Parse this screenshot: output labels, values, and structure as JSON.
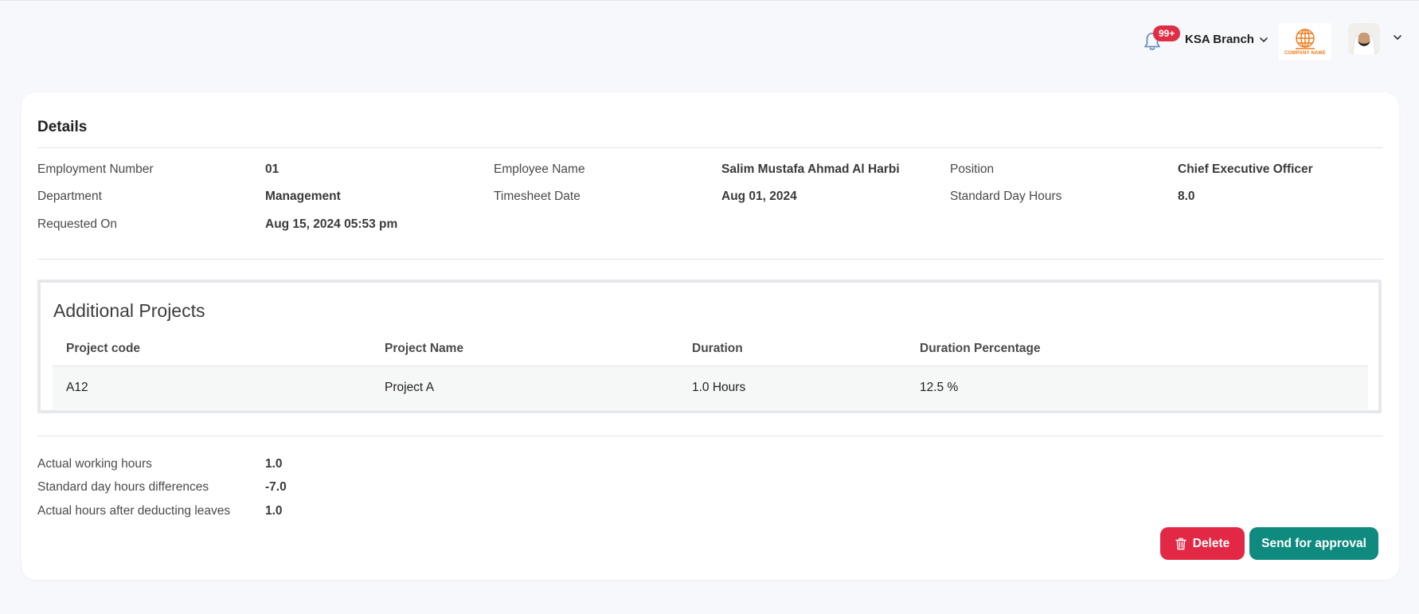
{
  "header": {
    "notification_badge": "99+",
    "branch": "KSA Branch",
    "company_logo_text": "COMPANY NAME",
    "colors": {
      "badge": "#e02e44",
      "logo": "#f07a1a"
    }
  },
  "details": {
    "title": "Details",
    "fields": {
      "employment_number": {
        "label": "Employment Number",
        "value": "01"
      },
      "employee_name": {
        "label": "Employee Name",
        "value": "Salim Mustafa Ahmad Al Harbi"
      },
      "position": {
        "label": "Position",
        "value": "Chief Executive Officer"
      },
      "department": {
        "label": "Department",
        "value": "Management"
      },
      "timesheet_date": {
        "label": "Timesheet Date",
        "value": "Aug 01, 2024"
      },
      "standard_day_hours": {
        "label": "Standard Day Hours",
        "value": "8.0"
      },
      "requested_on": {
        "label": "Requested On",
        "value": "Aug 15, 2024 05:53 pm"
      }
    }
  },
  "additional_projects": {
    "title": "Additional Projects",
    "columns": [
      "Project code",
      "Project Name",
      "Duration",
      "Duration Percentage"
    ],
    "rows": [
      {
        "code": "A12",
        "name": "Project A",
        "duration": "1.0 Hours",
        "percentage": "12.5 %"
      }
    ]
  },
  "summary": {
    "actual_working_hours": {
      "label": "Actual working hours",
      "value": "1.0"
    },
    "std_day_diff": {
      "label": "Standard day hours differences",
      "value": "-7.0"
    },
    "actual_after_leaves": {
      "label": "Actual hours after deducting leaves",
      "value": "1.0"
    }
  },
  "actions": {
    "delete_label": "Delete",
    "approve_label": "Send for approval",
    "colors": {
      "delete": "#e32845",
      "approve": "#0e8a7e"
    }
  }
}
